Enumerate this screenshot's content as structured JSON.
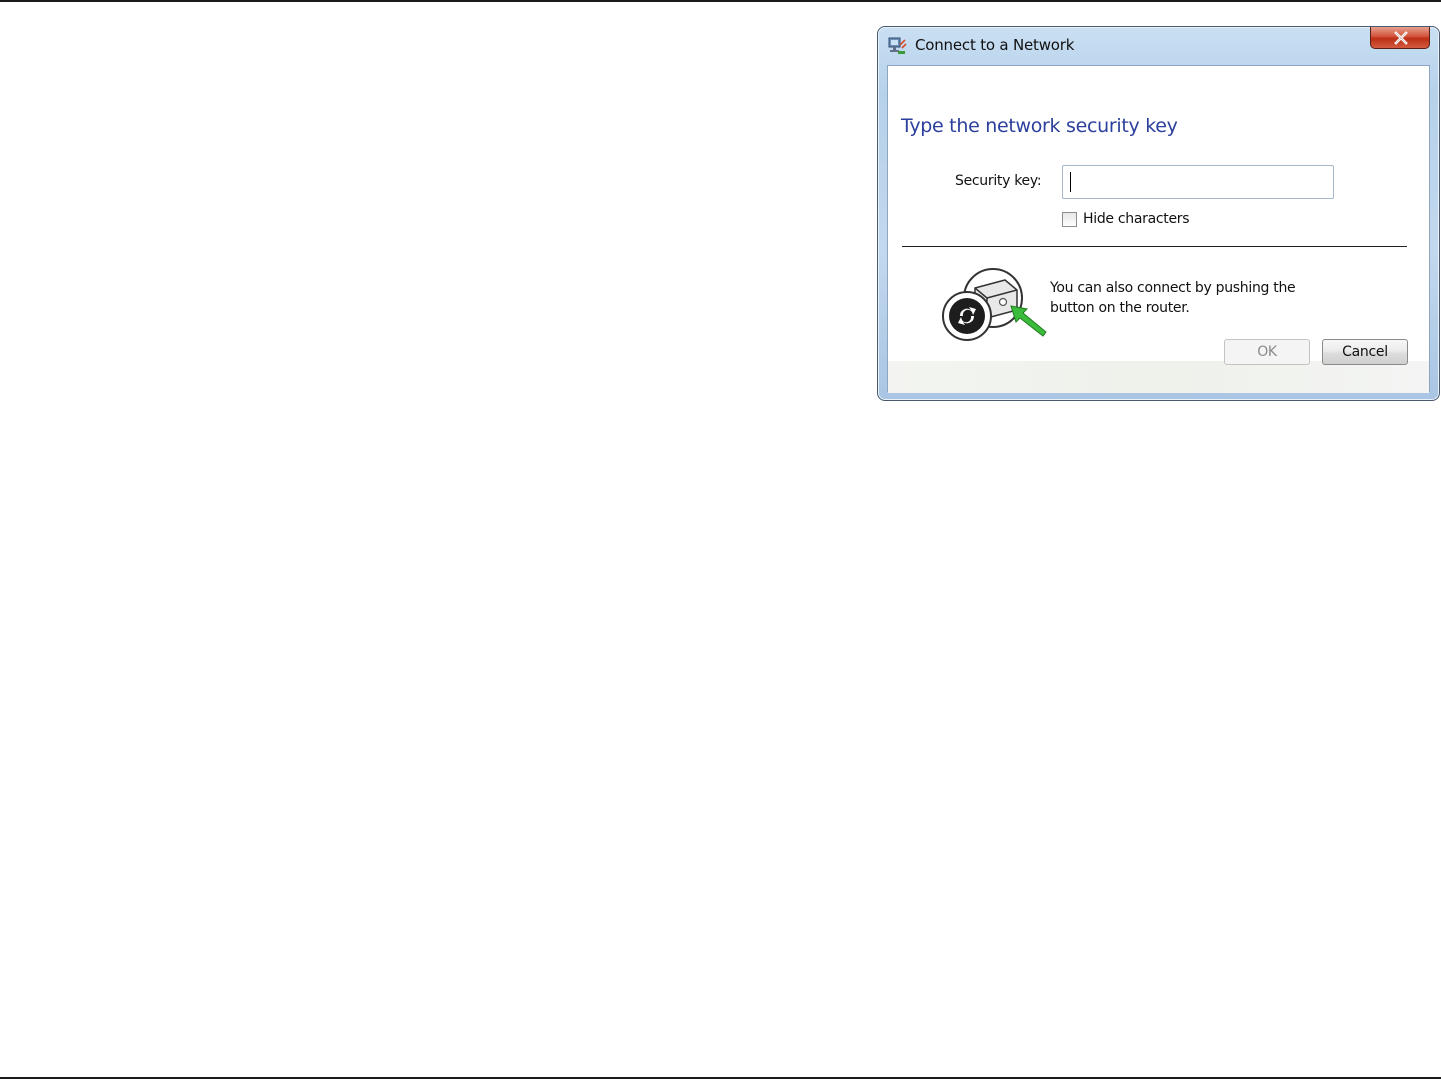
{
  "window": {
    "title": "Connect to a Network"
  },
  "dialog": {
    "heading": "Type the network security key",
    "security_key_label": "Security key:",
    "security_key_value": "",
    "hide_characters_label": "Hide characters",
    "hide_characters_checked": false,
    "wps_message": "You can also connect by pushing the button on the router."
  },
  "buttons": {
    "ok_label": "OK",
    "ok_enabled": false,
    "cancel_label": "Cancel"
  },
  "icons": {
    "title": "network-icon",
    "close": "close-icon",
    "wps": "wps-router-icon"
  }
}
